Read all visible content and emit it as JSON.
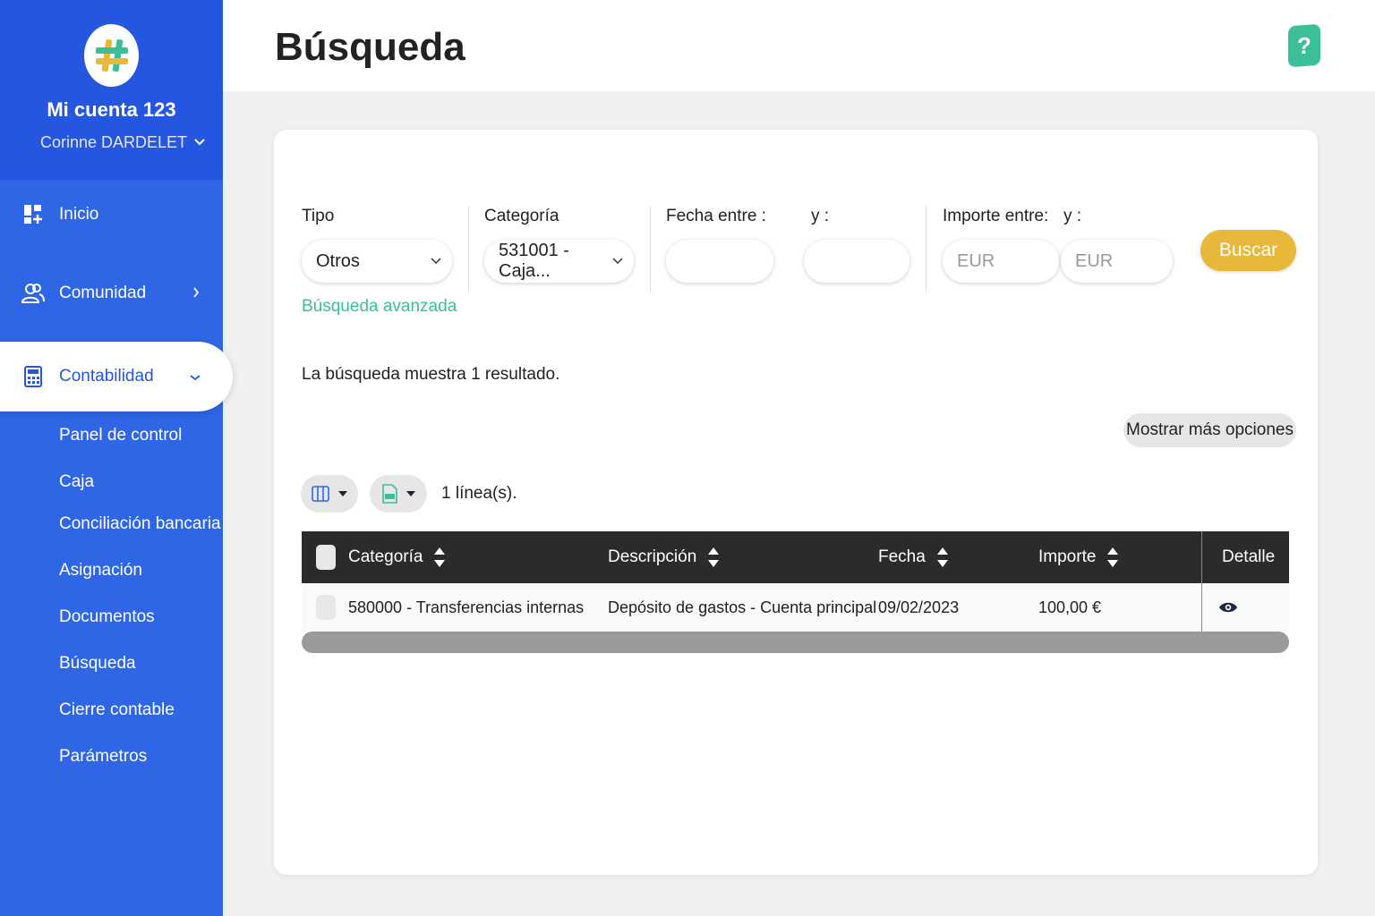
{
  "sidebar": {
    "account_name": "Mi cuenta 123",
    "user_name": "Corinne DARDELET",
    "nav": {
      "inicio": "Inicio",
      "comunidad": "Comunidad",
      "contabilidad": "Contabilidad"
    },
    "submenu": [
      "Panel de control",
      "Caja",
      "Conciliación bancaria",
      "Asignación",
      "Documentos",
      "Búsqueda",
      "Cierre contable",
      "Parámetros"
    ]
  },
  "header": {
    "title": "Búsqueda",
    "help_label": "?"
  },
  "filters": {
    "tipo_label": "Tipo",
    "tipo_value": "Otros",
    "categoria_label": "Categoría",
    "categoria_value": "531001 - Caja...",
    "fecha_label": "Fecha entre :",
    "fecha_y_label": "y :",
    "importe_label": "Importe entre:",
    "importe_y_label": "y :",
    "importe_min_placeholder": "EUR",
    "importe_max_placeholder": "EUR",
    "search_button": "Buscar",
    "advanced_link": "Búsqueda avanzada"
  },
  "results": {
    "summary": "La búsqueda muestra 1 resultado.",
    "more_options": "Mostrar más opciones",
    "lines_count": "1 línea(s)."
  },
  "table": {
    "columns": [
      "Categoría",
      "Descripción",
      "Fecha",
      "Importe",
      "Detalle"
    ],
    "rows": [
      {
        "categoria": "580000 - Transferencias internas",
        "descripcion": "Depósito de gastos - Cuenta principal",
        "fecha": "09/02/2023",
        "importe": "100,00 €"
      }
    ]
  },
  "colors": {
    "sidebar": "#2f66e6",
    "accent_green": "#3bbf99",
    "search_button": "#e8b83a",
    "table_header": "#2b2b2b"
  }
}
